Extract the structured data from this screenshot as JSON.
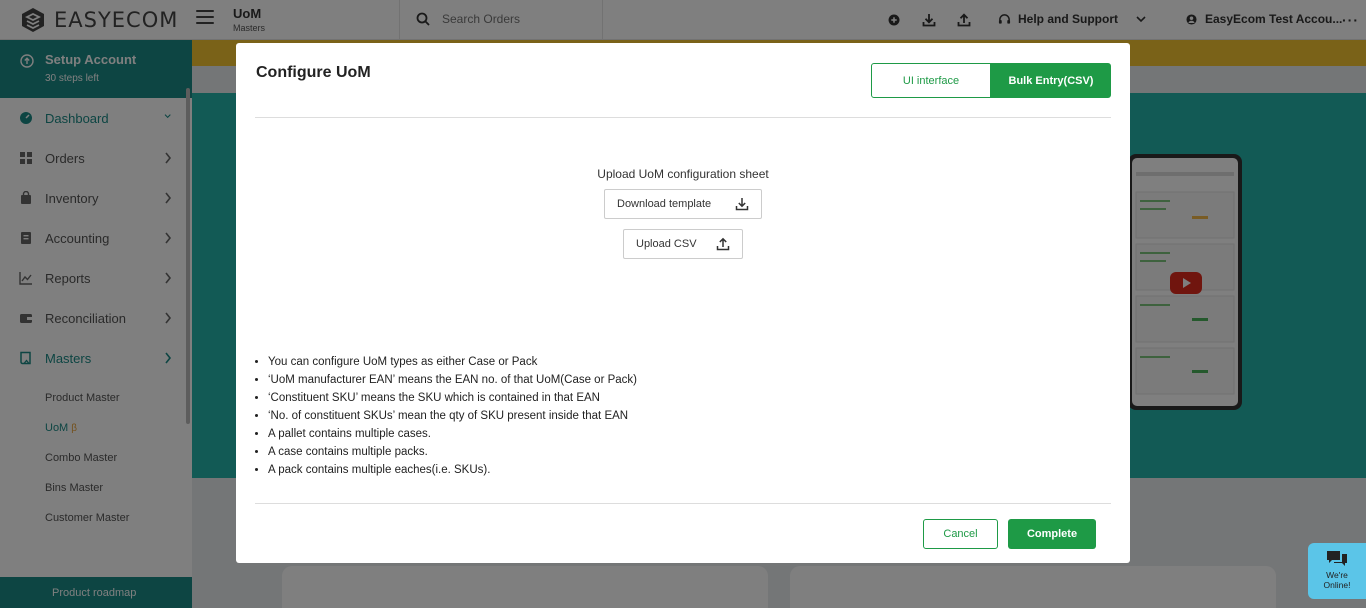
{
  "brand": {
    "name": "EASYECOM"
  },
  "header": {
    "title": "UoM",
    "subtitle": "Masters",
    "search_placeholder": "Search Orders",
    "help_label": "Help and Support",
    "user_label": "EasyEcom Test Accou...",
    "more_label": "···"
  },
  "sidebar": {
    "setup_title": "Setup Account",
    "setup_steps": "30 steps left",
    "items": [
      {
        "label": "Dashboard",
        "icon": "dashboard-icon"
      },
      {
        "label": "Orders",
        "icon": "grid-icon"
      },
      {
        "label": "Inventory",
        "icon": "bag-icon"
      },
      {
        "label": "Accounting",
        "icon": "ledger-icon"
      },
      {
        "label": "Reports",
        "icon": "chart-icon"
      },
      {
        "label": "Reconciliation",
        "icon": "wallet-icon"
      },
      {
        "label": "Masters",
        "icon": "book-icon"
      }
    ],
    "sub_items": [
      {
        "label": "Product Master"
      },
      {
        "label": "UoM",
        "badge": "β"
      },
      {
        "label": "Combo Master"
      },
      {
        "label": "Bins Master"
      },
      {
        "label": "Customer Master"
      }
    ],
    "roadmap_label": "Product roadmap"
  },
  "modal": {
    "title": "Configure UoM",
    "tabs": {
      "ui": "UI interface",
      "bulk": "Bulk Entry(CSV)"
    },
    "upload_title": "Upload UoM configuration sheet",
    "download_label": "Download template",
    "upload_label": "Upload CSV",
    "notes": [
      "You can configure UoM types as either Case or Pack",
      "‘UoM manufacturer EAN’ means the EAN no. of that UoM(Case or Pack)",
      "‘Constituent SKU’ means the SKU which is contained in that EAN",
      "‘No. of constituent SKUs’ mean the qty of SKU present inside that EAN",
      "A pallet contains multiple cases.",
      "A case contains multiple packs.",
      "A pack contains multiple eaches(i.e. SKUs)."
    ],
    "cancel_label": "Cancel",
    "complete_label": "Complete"
  },
  "chat": {
    "line1": "We're",
    "line2": "Online!"
  },
  "colors": {
    "teal": "#1a8a86",
    "green": "#1e9a46",
    "yellow": "#f4c430",
    "chat": "#5bc5e8"
  }
}
